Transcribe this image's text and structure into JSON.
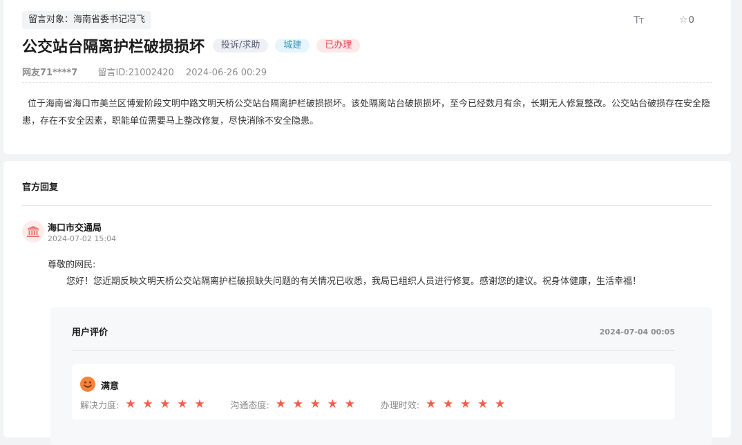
{
  "message": {
    "target_label": "留言对象：海南省委书记冯飞",
    "title": "公交站台隔离护栏破损损坏",
    "tags": {
      "type": "投诉/求助",
      "category": "城建",
      "status": "已办理"
    },
    "user": "网友71****7",
    "message_id": "留言ID:21002420",
    "datetime": "2024-06-26 00:29",
    "content": "位于海南省海口市美兰区博爱阶段文明中路文明天桥公交站台隔离护栏破损损坏。该处隔离站台破损损坏，至今已经数月有余，长期无人修复整改。公交站台破损存在安全隐患，存在不安全因素，职能单位需要马上整改修复，尽快消除不安全隐患。",
    "font_size_icon": "text-size-icon",
    "favorite_icon": "star-outline-icon",
    "favorite_count": "0"
  },
  "reply": {
    "section_title": "官方回复",
    "department": "海口市交通局",
    "department_icon": "government-building-icon",
    "datetime": "2024-07-02 15:04",
    "greeting": "尊敬的网民:",
    "body": "您好！您近期反映文明天桥公交站隔离护栏破损缺失问题的有关情况已收悉，我局已组织人员进行修复。感谢您的建议。祝身体健康，生活幸福！"
  },
  "evaluation": {
    "title": "用户评价",
    "datetime": "2024-07-04 00:05",
    "verdict": "满意",
    "verdict_icon": "smiley-face-icon",
    "ratings": [
      {
        "label": "解决力度:",
        "stars": 5
      },
      {
        "label": "沟通态度:",
        "stars": 5
      },
      {
        "label": "办理时效:",
        "stars": 5
      }
    ]
  },
  "colors": {
    "status_red": "#e0424f",
    "category_blue": "#3791c0",
    "star_orange": "#f25c47",
    "smiley_orange": "#f5833a"
  }
}
